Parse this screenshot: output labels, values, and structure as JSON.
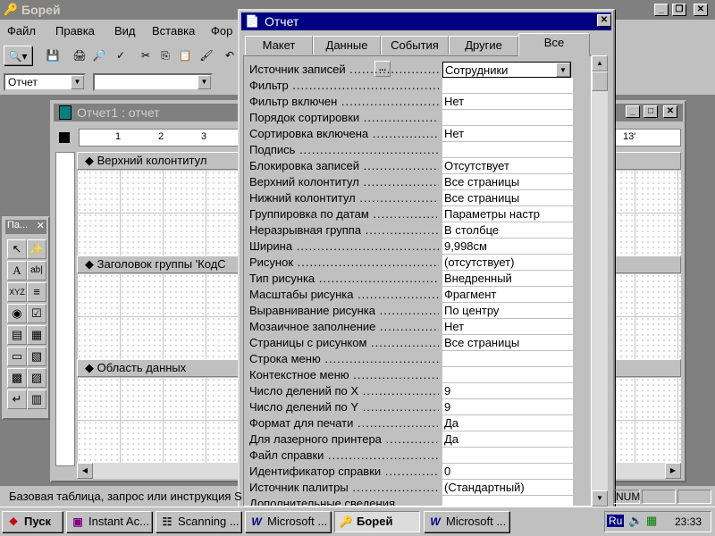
{
  "app": {
    "title": "Борей",
    "menu": [
      "Файл",
      "Правка",
      "Вид",
      "Вставка",
      "Фор"
    ],
    "format_combo": "Отчет"
  },
  "report_window": {
    "title": "Отчет1 : отчет",
    "ruler_right": "13'",
    "sections": [
      "Верхний колонтитул",
      "Заголовок группы 'КодС",
      "Область данных"
    ]
  },
  "toolbox": {
    "title": "Па..."
  },
  "property_sheet": {
    "title": "Отчет",
    "tabs": [
      "Макет",
      "Данные",
      "События",
      "Другие",
      "Все"
    ],
    "active_tab": "Все",
    "properties": [
      {
        "name": "Источник записей",
        "value": "Сотрудники"
      },
      {
        "name": "Фильтр",
        "value": ""
      },
      {
        "name": "Фильтр включен",
        "value": "Нет"
      },
      {
        "name": "Порядок сортировки",
        "value": ""
      },
      {
        "name": "Сортировка включена",
        "value": "Нет"
      },
      {
        "name": "Подпись",
        "value": ""
      },
      {
        "name": "Блокировка записей",
        "value": "Отсутствует"
      },
      {
        "name": "Верхний колонтитул",
        "value": "Все страницы"
      },
      {
        "name": "Нижний колонтитул",
        "value": "Все страницы"
      },
      {
        "name": "Группировка по датам",
        "value": "Параметры настр"
      },
      {
        "name": "Неразрывная группа",
        "value": "В столбце"
      },
      {
        "name": "Ширина",
        "value": "9,998см"
      },
      {
        "name": "Рисунок",
        "value": "(отсутствует)"
      },
      {
        "name": "Тип рисунка",
        "value": "Внедренный"
      },
      {
        "name": "Масштабы рисунка",
        "value": "Фрагмент"
      },
      {
        "name": "Выравнивание рисунка",
        "value": "По центру"
      },
      {
        "name": "Мозаичное заполнение",
        "value": "Нет"
      },
      {
        "name": "Страницы с рисунком",
        "value": "Все страницы"
      },
      {
        "name": "Строка меню",
        "value": ""
      },
      {
        "name": "Контекстное меню",
        "value": ""
      },
      {
        "name": "Число делений по X",
        "value": "9"
      },
      {
        "name": "Число делений по Y",
        "value": "9"
      },
      {
        "name": "Формат для печати",
        "value": "Да"
      },
      {
        "name": "Для лазерного принтера",
        "value": "Да"
      },
      {
        "name": "Файл справки",
        "value": ""
      },
      {
        "name": "Идентификатор справки",
        "value": "0"
      },
      {
        "name": "Источник палитры",
        "value": "(Стандартный)"
      },
      {
        "name": "Дополнительные сведения",
        "value": ""
      }
    ]
  },
  "statusbar": {
    "text": "Базовая таблица, запрос или инструкция S",
    "indicator": "NUM"
  },
  "taskbar": {
    "start": "Пуск",
    "tasks": [
      "Instant Ac...",
      "Scanning ...",
      "Microsoft ...",
      "Борей",
      "Microsoft ..."
    ],
    "active_task": "Борей",
    "lang": "Ru",
    "clock": "23:33"
  }
}
